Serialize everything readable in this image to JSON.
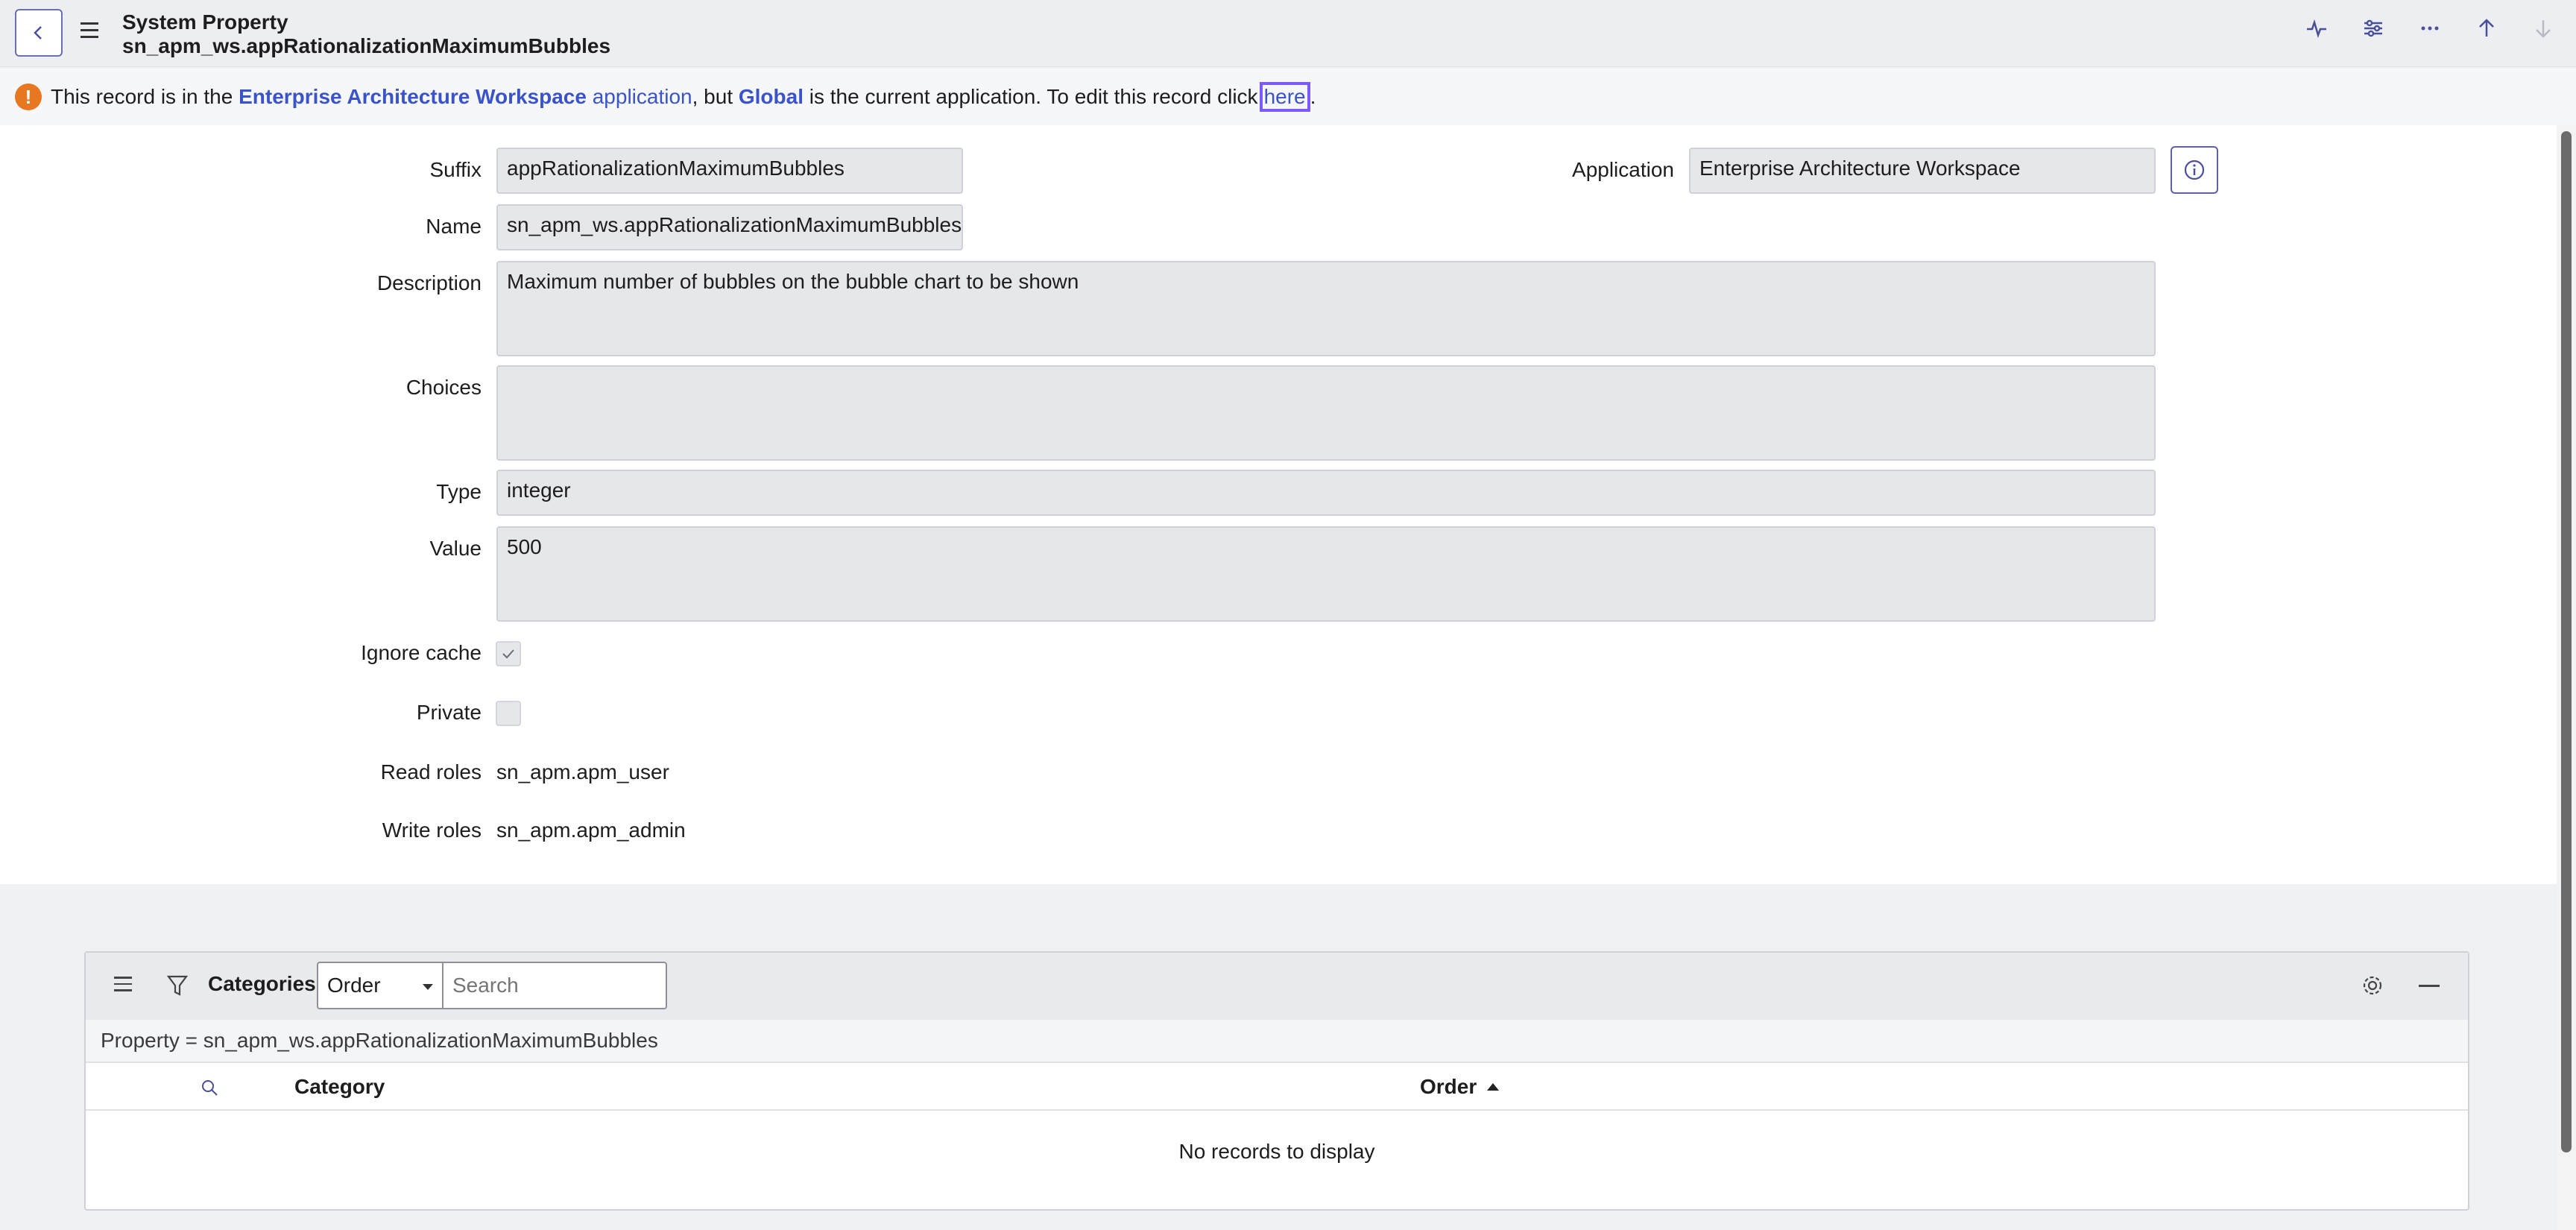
{
  "header": {
    "title": "System Property",
    "subtitle": "sn_apm_ws.appRationalizationMaximumBubbles"
  },
  "notice": {
    "prefix": "This record is in the",
    "app_name": "Enterprise Architecture Workspace",
    "app_word": "application",
    "mid": ", but",
    "current_app": "Global",
    "suffix": "is the current application. To edit this record click",
    "link": "here",
    "end": "."
  },
  "form": {
    "suffix_label": "Suffix",
    "suffix_value": "appRationalizationMaximumBubbles",
    "application_label": "Application",
    "application_value": "Enterprise Architecture Workspace",
    "name_label": "Name",
    "name_value": "sn_apm_ws.appRationalizationMaximumBubbles",
    "description_label": "Description",
    "description_value": "Maximum number of bubbles on the bubble chart to be shown",
    "choices_label": "Choices",
    "choices_value": "",
    "type_label": "Type",
    "type_value": "integer",
    "value_label": "Value",
    "value_value": "500",
    "ignore_cache_label": "Ignore cache",
    "ignore_cache_checked": true,
    "private_label": "Private",
    "private_checked": false,
    "read_roles_label": "Read roles",
    "read_roles_value": "sn_apm.apm_user",
    "write_roles_label": "Write roles",
    "write_roles_value": "sn_apm.apm_admin"
  },
  "related_list": {
    "title": "Categories",
    "sort_select": "Order",
    "search_placeholder": "Search",
    "filter_text": "Property = sn_apm_ws.appRationalizationMaximumBubbles",
    "columns": [
      "Category",
      "Order"
    ],
    "empty_text": "No records to display"
  },
  "icons": {
    "back": "chevron-left-icon",
    "menu": "hamburger-icon",
    "activity": "activity-icon",
    "settings": "sliders-icon",
    "more": "more-icon",
    "up": "arrow-up-icon",
    "down": "arrow-down-icon",
    "info": "info-icon",
    "filter": "filter-icon",
    "gear": "gear-icon",
    "minimize": "minimize-icon",
    "search": "search-icon"
  },
  "colors": {
    "accent": "#3a53c9",
    "warning": "#e87722",
    "focus": "#7a5af8"
  }
}
